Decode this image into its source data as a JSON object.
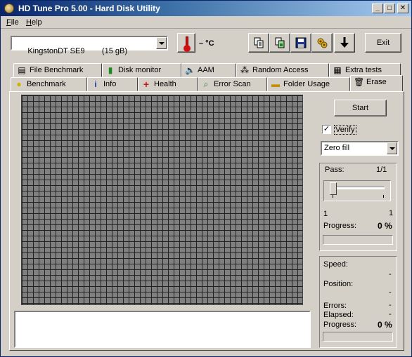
{
  "window": {
    "title": "HD Tune Pro 5.00 - Hard Disk Utility"
  },
  "menu": [
    {
      "accel": "F",
      "rest": "ile"
    },
    {
      "accel": "H",
      "rest": "elp"
    }
  ],
  "toolbar": {
    "drive": "KingstonDT SE9        (15 gB)",
    "temperature": "– °C",
    "exit_label": "Exit",
    "icons": [
      "copy-text-icon",
      "copy-screenshot-icon",
      "save-icon",
      "options-icon",
      "download-icon"
    ]
  },
  "tabs_top": [
    {
      "label": "File Benchmark",
      "icon": "file-benchmark-icon"
    },
    {
      "label": "Disk monitor",
      "icon": "disk-monitor-icon"
    },
    {
      "label": "AAM",
      "icon": "speaker-icon"
    },
    {
      "label": "Random Access",
      "icon": "random-access-icon"
    },
    {
      "label": "Extra tests",
      "icon": "extra-tests-icon"
    }
  ],
  "tabs_bottom": [
    {
      "label": "Benchmark",
      "icon": "lightbulb-icon"
    },
    {
      "label": "Info",
      "icon": "info-icon"
    },
    {
      "label": "Health",
      "icon": "health-cross-icon"
    },
    {
      "label": "Error Scan",
      "icon": "magnifier-icon"
    },
    {
      "label": "Folder Usage",
      "icon": "folder-icon"
    },
    {
      "label": "Erase",
      "icon": "trash-icon",
      "active": true
    }
  ],
  "erase": {
    "start_label": "Start",
    "verify_label": "Verify",
    "verify_checked": true,
    "method": "Zero fill",
    "pass": {
      "label": "Pass:",
      "value": "1/1",
      "min": "1",
      "max": "1",
      "progress_label": "Progress:",
      "progress_value": "0 %",
      "progress_fraction": 0
    },
    "stats": {
      "speed_label": "Speed:",
      "speed_value": "-",
      "position_label": "Position:",
      "position_value": "-",
      "errors_label": "Errors:",
      "errors_value": "-",
      "elapsed_label": "Elapsed:",
      "elapsed_value": "-",
      "progress_label": "Progress:",
      "progress_value": "0 %",
      "progress_fraction": 0
    }
  },
  "colors": {
    "title_active": "#0a246a",
    "face": "#d4d0c8",
    "block_grid": "#808080"
  }
}
